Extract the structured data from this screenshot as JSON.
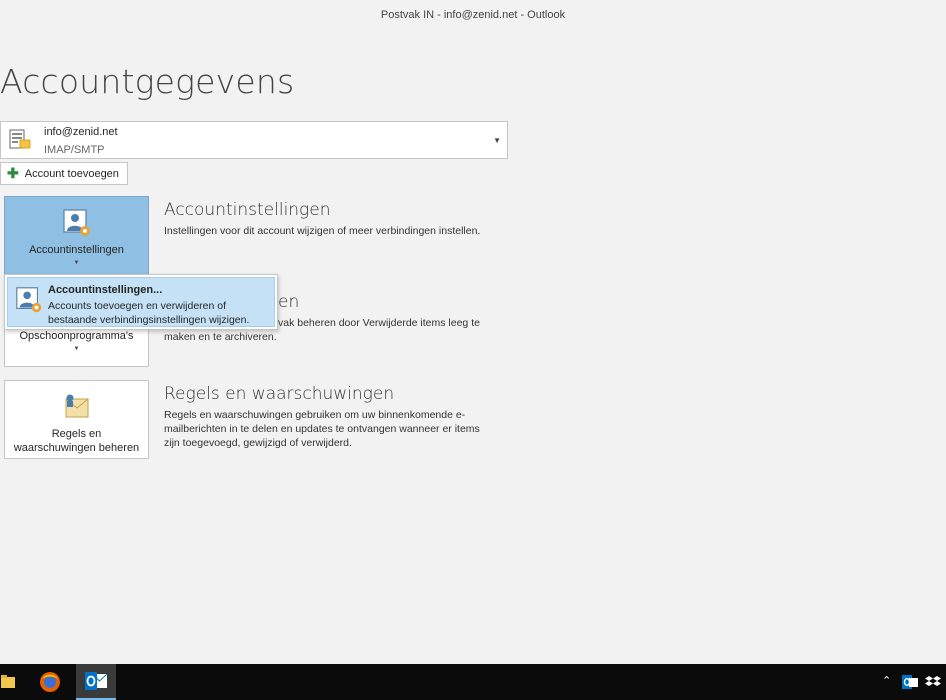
{
  "window": {
    "title": "Postvak IN - info@zenid.net - Outlook"
  },
  "page": {
    "title": "Accountgegevens"
  },
  "account": {
    "email": "info@zenid.net",
    "type": "IMAP/SMTP"
  },
  "add_account": {
    "label": "Account toevoegen"
  },
  "tiles": {
    "settings": {
      "label": "Accountinstellingen"
    },
    "cleanup": {
      "label": "Opschoonprogramma's"
    },
    "rules": {
      "label_line1": "Regels en",
      "label_line2": "waarschuwingen beheren"
    }
  },
  "sections": {
    "settings": {
      "title": "Accountinstellingen",
      "desc": "Instellingen voor dit account wijzigen of meer verbindingen instellen."
    },
    "cleanup": {
      "title_partial": "en",
      "desc_line1": "vak beheren door Verwijderde items leeg te",
      "desc_line2": "maken en te archiveren."
    },
    "rules": {
      "title": "Regels en waarschuwingen",
      "desc_line1": "Regels en waarschuwingen gebruiken om uw binnenkomende e-",
      "desc_line2": "mailberichten in te delen en updates te ontvangen wanneer er items",
      "desc_line3": "zijn toegevoegd, gewijzigd of verwijderd."
    }
  },
  "dropdown": {
    "item_title": "Accountinstellingen...",
    "item_desc_line1": "Accounts toevoegen en verwijderen of",
    "item_desc_line2": "bestaande verbindingsinstellingen wijzigen."
  },
  "colors": {
    "accent": "#8fbfe2",
    "menu_highlight": "#c5e1f5",
    "taskbar": "#0b0b0b"
  }
}
